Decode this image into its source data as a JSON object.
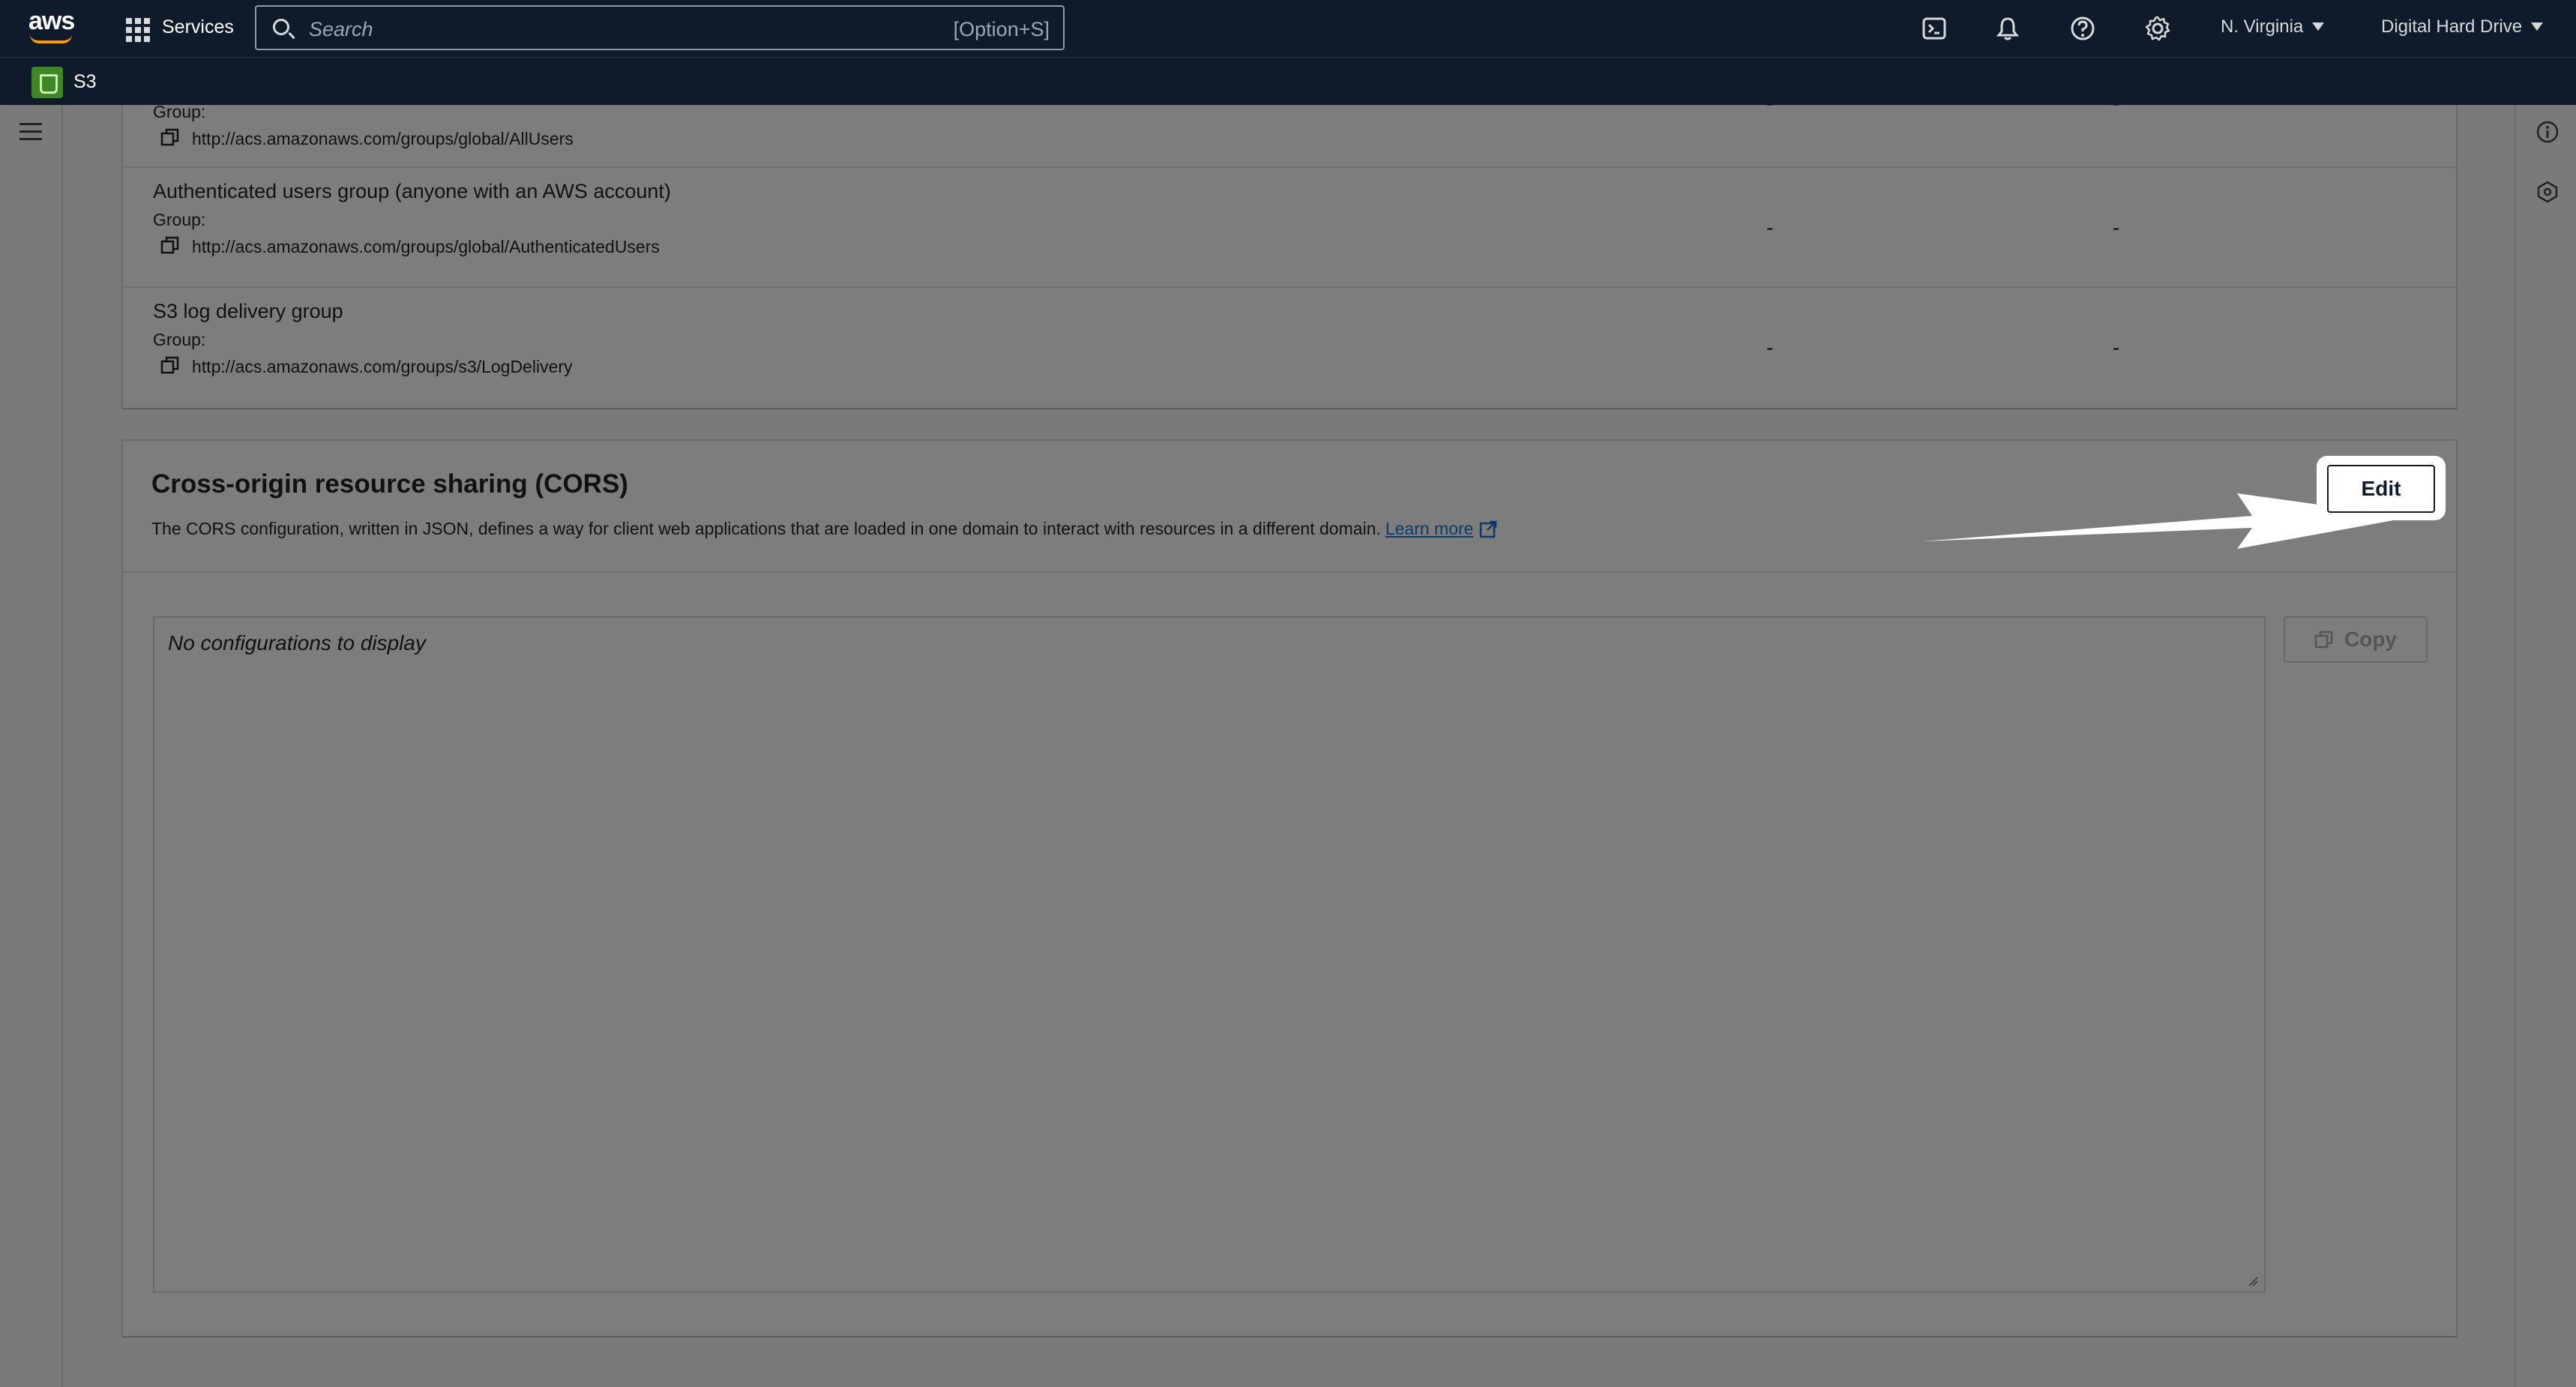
{
  "topnav": {
    "logo_text": "aws",
    "services_label": "Services",
    "search_placeholder": "Search",
    "search_shortcut": "[Option+S]",
    "region": "N. Virginia",
    "account": "Digital Hard Drive",
    "icons": [
      "cloudshell-icon",
      "bell-icon",
      "help-icon",
      "gear-icon"
    ]
  },
  "service": {
    "name": "S3",
    "badge_color": "#3f8624"
  },
  "permissions": {
    "rows": [
      {
        "name": "",
        "group_label": "Group:",
        "url": "http://acs.amazonaws.com/groups/global/AllUsers",
        "col1": "-",
        "col2": "-"
      },
      {
        "name": "Authenticated users group (anyone with an AWS account)",
        "group_label": "Group:",
        "url": "http://acs.amazonaws.com/groups/global/AuthenticatedUsers",
        "col1": "-",
        "col2": "-"
      },
      {
        "name": "S3 log delivery group",
        "group_label": "Group:",
        "url": "http://acs.amazonaws.com/groups/s3/LogDelivery",
        "col1": "-",
        "col2": "-"
      }
    ]
  },
  "cors": {
    "title": "Cross-origin resource sharing (CORS)",
    "description": "The CORS configuration, written in JSON, defines a way for client web applications that are loaded in one domain to interact with resources in a different domain.",
    "learn_more": "Learn more",
    "edit_label": "Edit",
    "copy_label": "Copy",
    "empty_text": "No configurations to display"
  },
  "colors": {
    "nav_bg": "#0f1b2a",
    "overlay_bg": "#7a7a7a",
    "link": "#0b3b66",
    "arrow": "#ffffff"
  }
}
